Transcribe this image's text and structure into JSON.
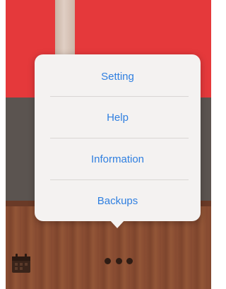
{
  "colors": {
    "red_band": "#e5393b",
    "gray_band": "#5b5450",
    "wood": "#8a4d33",
    "menu_text": "#2f7fe0",
    "popover_bg": "#f4f2f1"
  },
  "menu": {
    "items": [
      {
        "label": "Setting"
      },
      {
        "label": "Help"
      },
      {
        "label": "Information"
      },
      {
        "label": "Backups"
      }
    ]
  },
  "toolbar": {
    "left_icon": "calendar-icon",
    "center_icon": "more-icon"
  }
}
